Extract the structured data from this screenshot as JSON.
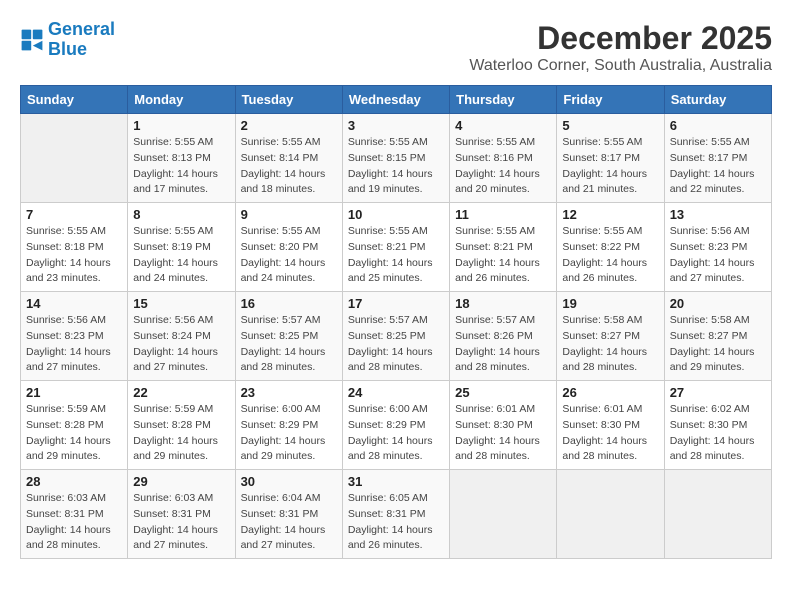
{
  "header": {
    "logo_line1": "General",
    "logo_line2": "Blue",
    "month": "December 2025",
    "location": "Waterloo Corner, South Australia, Australia"
  },
  "days_of_week": [
    "Sunday",
    "Monday",
    "Tuesday",
    "Wednesday",
    "Thursday",
    "Friday",
    "Saturday"
  ],
  "weeks": [
    [
      {
        "day": "",
        "info": ""
      },
      {
        "day": "1",
        "info": "Sunrise: 5:55 AM\nSunset: 8:13 PM\nDaylight: 14 hours\nand 17 minutes."
      },
      {
        "day": "2",
        "info": "Sunrise: 5:55 AM\nSunset: 8:14 PM\nDaylight: 14 hours\nand 18 minutes."
      },
      {
        "day": "3",
        "info": "Sunrise: 5:55 AM\nSunset: 8:15 PM\nDaylight: 14 hours\nand 19 minutes."
      },
      {
        "day": "4",
        "info": "Sunrise: 5:55 AM\nSunset: 8:16 PM\nDaylight: 14 hours\nand 20 minutes."
      },
      {
        "day": "5",
        "info": "Sunrise: 5:55 AM\nSunset: 8:17 PM\nDaylight: 14 hours\nand 21 minutes."
      },
      {
        "day": "6",
        "info": "Sunrise: 5:55 AM\nSunset: 8:17 PM\nDaylight: 14 hours\nand 22 minutes."
      }
    ],
    [
      {
        "day": "7",
        "info": "Sunrise: 5:55 AM\nSunset: 8:18 PM\nDaylight: 14 hours\nand 23 minutes."
      },
      {
        "day": "8",
        "info": "Sunrise: 5:55 AM\nSunset: 8:19 PM\nDaylight: 14 hours\nand 24 minutes."
      },
      {
        "day": "9",
        "info": "Sunrise: 5:55 AM\nSunset: 8:20 PM\nDaylight: 14 hours\nand 24 minutes."
      },
      {
        "day": "10",
        "info": "Sunrise: 5:55 AM\nSunset: 8:21 PM\nDaylight: 14 hours\nand 25 minutes."
      },
      {
        "day": "11",
        "info": "Sunrise: 5:55 AM\nSunset: 8:21 PM\nDaylight: 14 hours\nand 26 minutes."
      },
      {
        "day": "12",
        "info": "Sunrise: 5:55 AM\nSunset: 8:22 PM\nDaylight: 14 hours\nand 26 minutes."
      },
      {
        "day": "13",
        "info": "Sunrise: 5:56 AM\nSunset: 8:23 PM\nDaylight: 14 hours\nand 27 minutes."
      }
    ],
    [
      {
        "day": "14",
        "info": "Sunrise: 5:56 AM\nSunset: 8:23 PM\nDaylight: 14 hours\nand 27 minutes."
      },
      {
        "day": "15",
        "info": "Sunrise: 5:56 AM\nSunset: 8:24 PM\nDaylight: 14 hours\nand 27 minutes."
      },
      {
        "day": "16",
        "info": "Sunrise: 5:57 AM\nSunset: 8:25 PM\nDaylight: 14 hours\nand 28 minutes."
      },
      {
        "day": "17",
        "info": "Sunrise: 5:57 AM\nSunset: 8:25 PM\nDaylight: 14 hours\nand 28 minutes."
      },
      {
        "day": "18",
        "info": "Sunrise: 5:57 AM\nSunset: 8:26 PM\nDaylight: 14 hours\nand 28 minutes."
      },
      {
        "day": "19",
        "info": "Sunrise: 5:58 AM\nSunset: 8:27 PM\nDaylight: 14 hours\nand 28 minutes."
      },
      {
        "day": "20",
        "info": "Sunrise: 5:58 AM\nSunset: 8:27 PM\nDaylight: 14 hours\nand 29 minutes."
      }
    ],
    [
      {
        "day": "21",
        "info": "Sunrise: 5:59 AM\nSunset: 8:28 PM\nDaylight: 14 hours\nand 29 minutes."
      },
      {
        "day": "22",
        "info": "Sunrise: 5:59 AM\nSunset: 8:28 PM\nDaylight: 14 hours\nand 29 minutes."
      },
      {
        "day": "23",
        "info": "Sunrise: 6:00 AM\nSunset: 8:29 PM\nDaylight: 14 hours\nand 29 minutes."
      },
      {
        "day": "24",
        "info": "Sunrise: 6:00 AM\nSunset: 8:29 PM\nDaylight: 14 hours\nand 28 minutes."
      },
      {
        "day": "25",
        "info": "Sunrise: 6:01 AM\nSunset: 8:30 PM\nDaylight: 14 hours\nand 28 minutes."
      },
      {
        "day": "26",
        "info": "Sunrise: 6:01 AM\nSunset: 8:30 PM\nDaylight: 14 hours\nand 28 minutes."
      },
      {
        "day": "27",
        "info": "Sunrise: 6:02 AM\nSunset: 8:30 PM\nDaylight: 14 hours\nand 28 minutes."
      }
    ],
    [
      {
        "day": "28",
        "info": "Sunrise: 6:03 AM\nSunset: 8:31 PM\nDaylight: 14 hours\nand 28 minutes."
      },
      {
        "day": "29",
        "info": "Sunrise: 6:03 AM\nSunset: 8:31 PM\nDaylight: 14 hours\nand 27 minutes."
      },
      {
        "day": "30",
        "info": "Sunrise: 6:04 AM\nSunset: 8:31 PM\nDaylight: 14 hours\nand 27 minutes."
      },
      {
        "day": "31",
        "info": "Sunrise: 6:05 AM\nSunset: 8:31 PM\nDaylight: 14 hours\nand 26 minutes."
      },
      {
        "day": "",
        "info": ""
      },
      {
        "day": "",
        "info": ""
      },
      {
        "day": "",
        "info": ""
      }
    ]
  ]
}
